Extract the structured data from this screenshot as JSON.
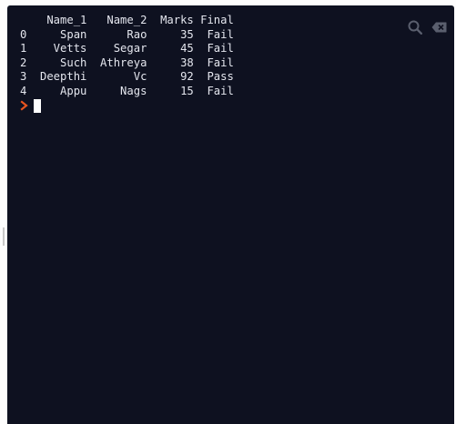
{
  "console": {
    "output_lines": [
      "    Name_1   Name_2  Marks Final",
      "0     Span      Rao     35  Fail",
      "1    Vetts    Segar     45  Fail",
      "2     Such  Athreya     38  Fail",
      "3  Deepthi       Vc     92  Pass",
      "4     Appu     Nags     15  Fail"
    ]
  },
  "toolbar": {
    "search_icon": "search-icon",
    "clear_icon": "clear-console-icon"
  },
  "colors": {
    "background": "#0e1120",
    "text": "#e4e6ee",
    "prompt": "#e8551f",
    "cursor": "#ffffff",
    "icons": "#5a5f6e"
  }
}
